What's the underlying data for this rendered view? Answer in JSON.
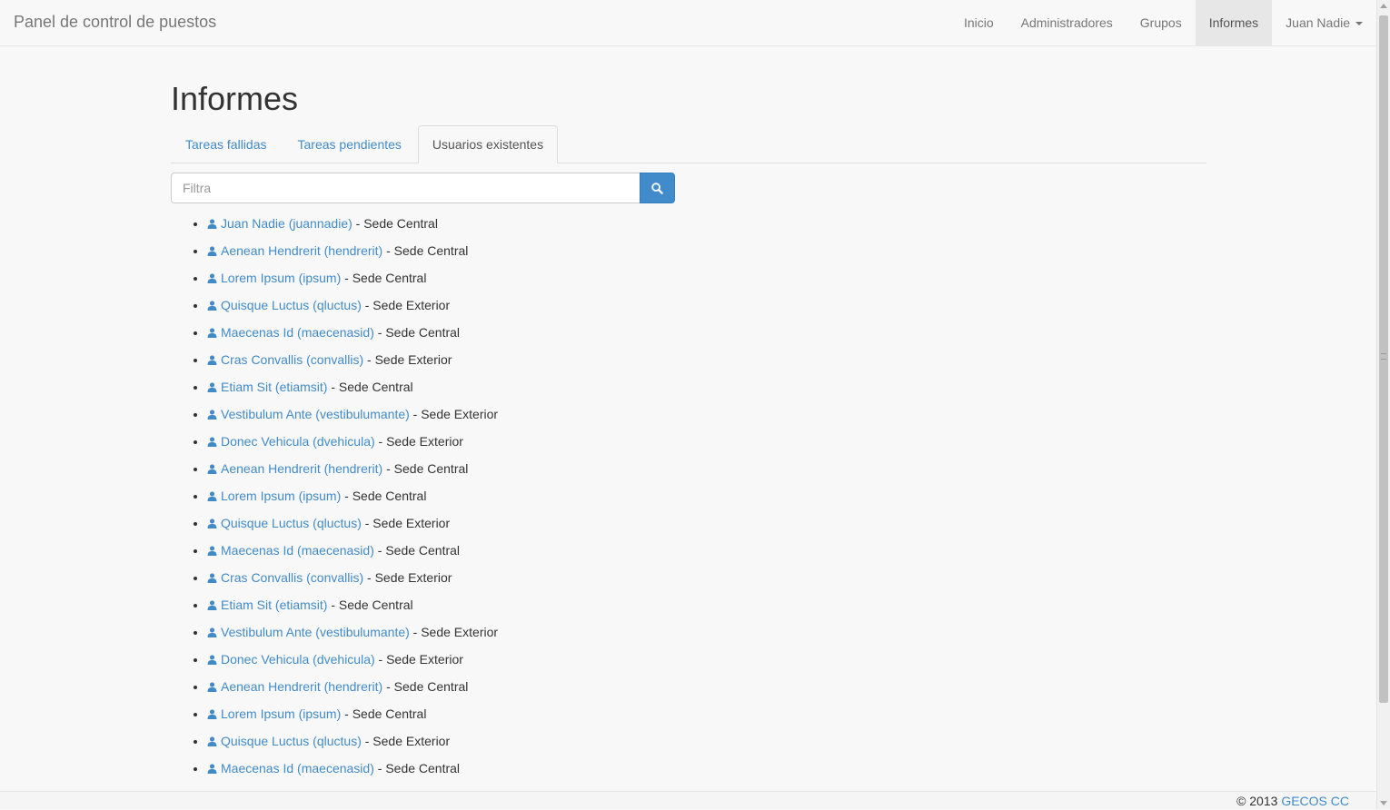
{
  "navbar": {
    "brand": "Panel de control de puestos",
    "items": [
      {
        "label": "Inicio",
        "active": false
      },
      {
        "label": "Administradores",
        "active": false
      },
      {
        "label": "Grupos",
        "active": false
      },
      {
        "label": "Informes",
        "active": true
      }
    ],
    "user_menu": "Juan Nadie"
  },
  "page": {
    "title": "Informes",
    "tabs": [
      {
        "label": "Tareas fallidas",
        "active": false
      },
      {
        "label": "Tareas pendientes",
        "active": false
      },
      {
        "label": "Usuarios existentes",
        "active": true
      }
    ],
    "search": {
      "placeholder": "Filtra",
      "value": ""
    }
  },
  "users": [
    {
      "name": "Juan Nadie (juannadie)",
      "site": " - Sede Central"
    },
    {
      "name": "Aenean Hendrerit (hendrerit)",
      "site": " - Sede Central"
    },
    {
      "name": "Lorem Ipsum (ipsum)",
      "site": " - Sede Central"
    },
    {
      "name": "Quisque Luctus (qluctus)",
      "site": " - Sede Exterior"
    },
    {
      "name": "Maecenas Id (maecenasid)",
      "site": " - Sede Central"
    },
    {
      "name": "Cras Convallis (convallis)",
      "site": " - Sede Exterior"
    },
    {
      "name": "Etiam Sit (etiamsit)",
      "site": " - Sede Central"
    },
    {
      "name": "Vestibulum Ante (vestibulumante)",
      "site": " - Sede Exterior"
    },
    {
      "name": "Donec Vehicula (dvehicula)",
      "site": " - Sede Exterior"
    },
    {
      "name": "Aenean Hendrerit (hendrerit)",
      "site": " - Sede Central"
    },
    {
      "name": "Lorem Ipsum (ipsum)",
      "site": " - Sede Central"
    },
    {
      "name": "Quisque Luctus (qluctus)",
      "site": " - Sede Exterior"
    },
    {
      "name": "Maecenas Id (maecenasid)",
      "site": " - Sede Central"
    },
    {
      "name": "Cras Convallis (convallis)",
      "site": " - Sede Exterior"
    },
    {
      "name": "Etiam Sit (etiamsit)",
      "site": " - Sede Central"
    },
    {
      "name": "Vestibulum Ante (vestibulumante)",
      "site": " - Sede Exterior"
    },
    {
      "name": "Donec Vehicula (dvehicula)",
      "site": " - Sede Exterior"
    },
    {
      "name": "Aenean Hendrerit (hendrerit)",
      "site": " - Sede Central"
    },
    {
      "name": "Lorem Ipsum (ipsum)",
      "site": " - Sede Central"
    },
    {
      "name": "Quisque Luctus (qluctus)",
      "site": " - Sede Exterior"
    },
    {
      "name": "Maecenas Id (maecenasid)",
      "site": " - Sede Central"
    }
  ],
  "footer": {
    "copyright": "© 2013 ",
    "link": "GECOS CC"
  },
  "icons": {
    "user": "user-icon",
    "search": "search-icon",
    "dropdown": "caret-down-icon"
  },
  "colors": {
    "link": "#428bca",
    "active_nav_bg": "#e7e7e7",
    "primary_button": "#428bca"
  }
}
